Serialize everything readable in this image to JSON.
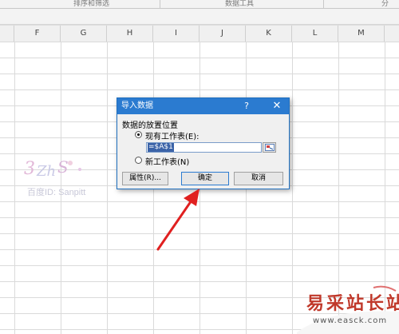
{
  "ribbon": {
    "groups": [
      "排序和筛选",
      "数据工具",
      "分"
    ]
  },
  "columns": [
    "F",
    "G",
    "H",
    "I",
    "J",
    "K",
    "L",
    "M"
  ],
  "dialog": {
    "title": "导入数据",
    "help_label": "?",
    "close_label": "✕",
    "section_label": "数据的放置位置",
    "existing_sheet_label": "现有工作表(E):",
    "existing_sheet_selected": true,
    "range_value": "=$A$1",
    "new_sheet_label": "新工作表(N)",
    "new_sheet_selected": false,
    "properties_button": "属性(R)...",
    "ok_button": "确定",
    "cancel_button": "取消"
  },
  "watermark": {
    "text": "百度ID: Sanpitt"
  },
  "site_logo": {
    "name": "易采站长站",
    "url": "www.easck.com"
  },
  "colors": {
    "title_bar": "#2b7bd0",
    "arrow": "#e02020",
    "logo": "#c0392b"
  }
}
